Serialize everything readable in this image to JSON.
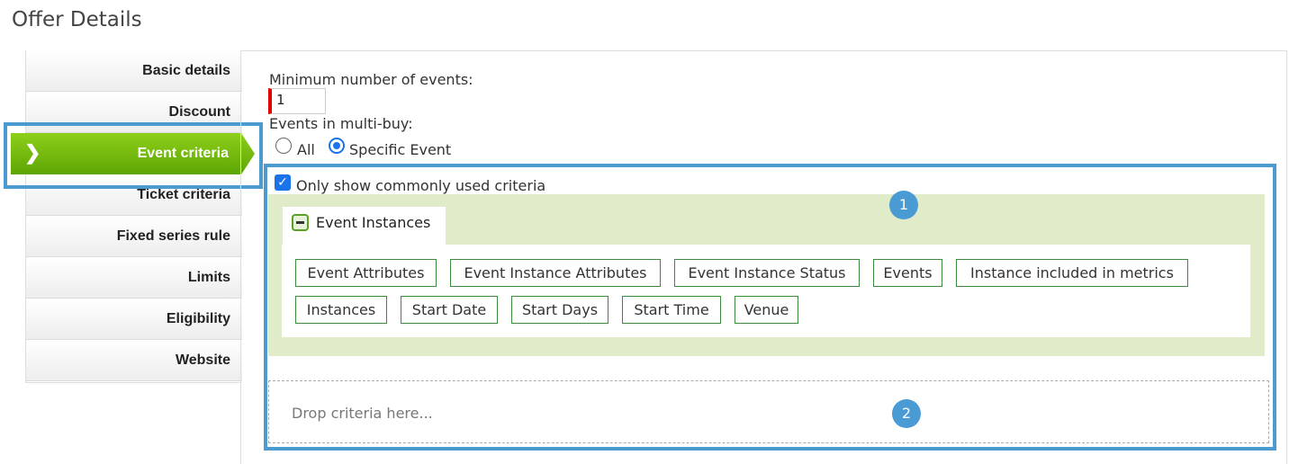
{
  "page": {
    "title": "Offer Details"
  },
  "sidebar": {
    "items": [
      {
        "label": "Basic details"
      },
      {
        "label": "Discount"
      },
      {
        "label": "Event criteria",
        "active": true
      },
      {
        "label": "Ticket criteria"
      },
      {
        "label": "Fixed series rule"
      },
      {
        "label": "Limits"
      },
      {
        "label": "Eligibility"
      },
      {
        "label": "Website"
      }
    ],
    "active_icon": "chevron-right-icon"
  },
  "form": {
    "min_events_label": "Minimum number of events:",
    "min_events_value": "1",
    "multibuy_label": "Events in multi-buy:",
    "radio_all": "All",
    "radio_specific": "Specific Event",
    "selected_radio": "Specific Event"
  },
  "criteria": {
    "common_only_label": "Only show commonly used criteria",
    "common_only_checked": true,
    "group_title": "Event Instances",
    "chips": [
      "Event Attributes",
      "Event Instance Attributes",
      "Event Instance Status",
      "Events",
      "Instance included in metrics",
      "Instances",
      "Start Date",
      "Start Days",
      "Start Time",
      "Venue"
    ],
    "drop_placeholder": "Drop criteria here..."
  },
  "annotations": {
    "badge1": "1",
    "badge2": "2"
  },
  "colors": {
    "active_tab": "#6db30e",
    "highlight": "#4b9bd0",
    "group_bg": "#dfebc9",
    "chip_border": "#3c8a3c",
    "required": "#e00000",
    "badge": "#4a9ad4"
  }
}
